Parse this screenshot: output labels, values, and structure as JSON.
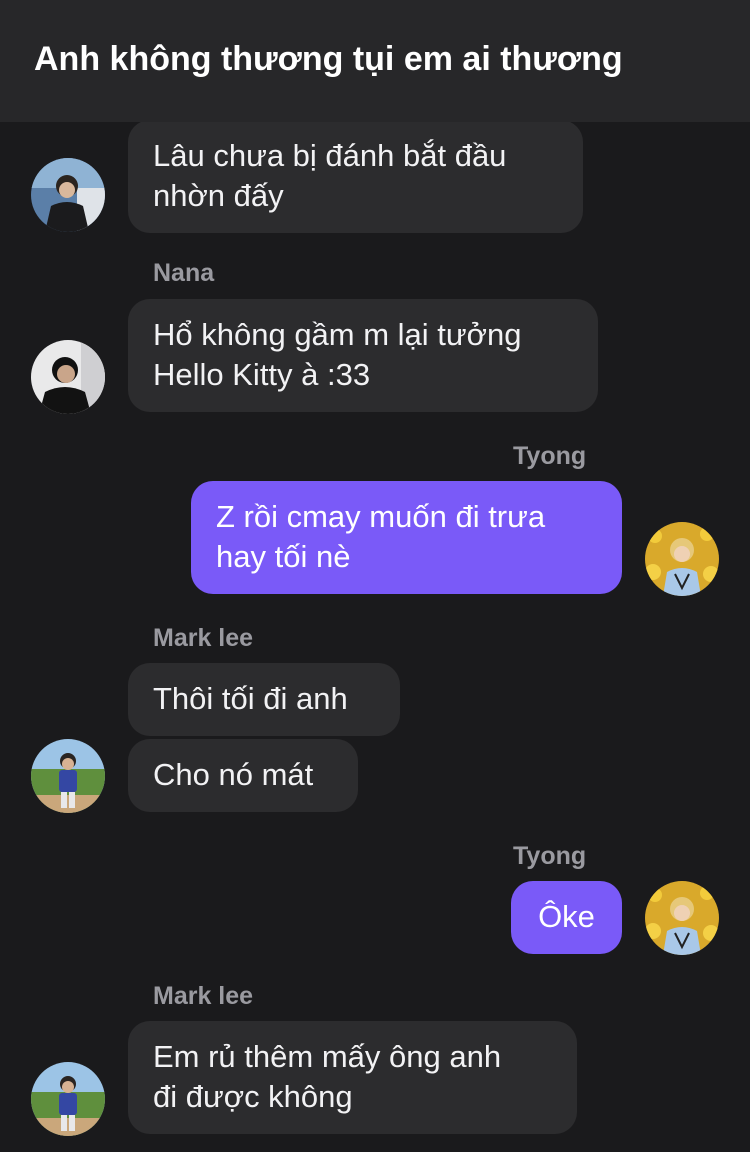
{
  "header": {
    "title": "Anh không thương tụi em ai thương"
  },
  "messages": [
    {
      "sender": "",
      "text_lines": [
        "Lâu chưa bị đánh bắt đầu",
        "nhờn đấy"
      ],
      "mine": false
    },
    {
      "sender": "Nana",
      "text_lines": [
        "Hổ không gầm m lại tưởng",
        "Hello Kitty à :33"
      ],
      "mine": false
    },
    {
      "sender": "Tyong",
      "text_lines": [
        "Z rồi cmay muốn đi trưa",
        "hay tối nè"
      ],
      "mine": true
    },
    {
      "sender": "Mark lee",
      "text_lines": [
        "Thôi tối đi anh"
      ],
      "mine": false
    },
    {
      "sender": "",
      "text_lines": [
        "Cho nó mát"
      ],
      "mine": false
    },
    {
      "sender": "Tyong",
      "text_lines": [
        "Ôke"
      ],
      "mine": true
    },
    {
      "sender": "Mark lee",
      "text_lines": [
        "Em rủ thêm mấy ông anh",
        "đi được không"
      ],
      "mine": false
    }
  ],
  "colors": {
    "background": "#1a1a1c",
    "header": "#272729",
    "bubble_other": "#2c2c2e",
    "bubble_mine": "#7a5af8",
    "sender_name": "#9a9aa0"
  }
}
